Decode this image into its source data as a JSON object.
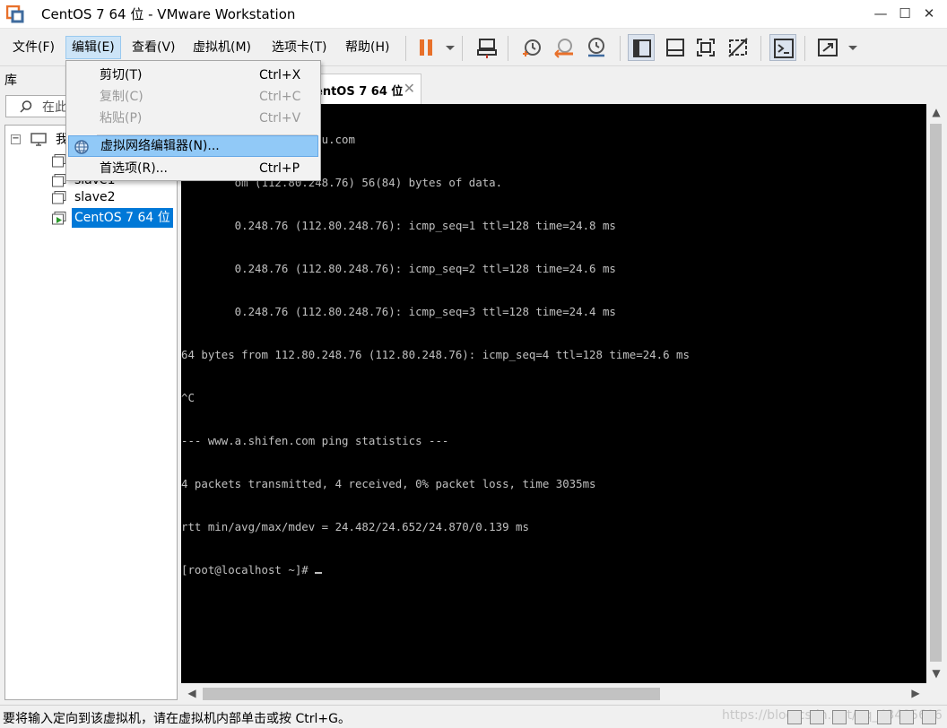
{
  "window": {
    "title": "CentOS 7 64 位 - VMware Workstation",
    "minimize": "—",
    "maximize": "☐",
    "close": "✕"
  },
  "menubar": {
    "items": [
      {
        "label": "文件(F)"
      },
      {
        "label": "编辑(E)"
      },
      {
        "label": "查看(V)"
      },
      {
        "label": "虚拟机(M)"
      },
      {
        "label": "选项卡(T)"
      },
      {
        "label": "帮助(H)"
      }
    ],
    "active_index": 1
  },
  "toolbar": {
    "icons": [
      "pause-icon",
      "dropdown-arrow-icon",
      "send-ctrl-alt-del-icon",
      "take-snapshot-icon",
      "revert-snapshot-icon",
      "snapshot-manager-icon",
      "show-library-icon",
      "thumbnail-bar-icon",
      "full-screen-icon",
      "unity-icon",
      "console-view-icon",
      "stretch-guest-icon",
      "stretch-dropdown-icon"
    ],
    "accent": "#e8702a"
  },
  "library": {
    "header": "库",
    "search_placeholder": "在此",
    "root_label": "我",
    "items": [
      {
        "label": ""
      },
      {
        "label": "slave1"
      },
      {
        "label": "slave2"
      },
      {
        "label": "CentOS 7 64 位"
      }
    ],
    "selected_index": 3
  },
  "tabs": {
    "active_label": "CentOS 7 64 位",
    "partial_visible_label": "entOS 7 64 位"
  },
  "edit_menu": {
    "items": [
      {
        "label": "剪切(T)",
        "shortcut": "Ctrl+X",
        "disabled": false
      },
      {
        "label": "复制(C)",
        "shortcut": "Ctrl+C",
        "disabled": true
      },
      {
        "label": "粘贴(P)",
        "shortcut": "Ctrl+V",
        "disabled": true
      },
      {
        "label": "虚拟网络编辑器(N)...",
        "shortcut": "",
        "disabled": false,
        "hovered": true
      },
      {
        "label": "首选项(R)...",
        "shortcut": "Ctrl+P",
        "disabled": false
      }
    ]
  },
  "console": {
    "lines": [
      "        ping www.baidu.com",
      "        om (112.80.248.76) 56(84) bytes of data.",
      "        0.248.76 (112.80.248.76): icmp_seq=1 ttl=128 time=24.8 ms",
      "        0.248.76 (112.80.248.76): icmp_seq=2 ttl=128 time=24.6 ms",
      "        0.248.76 (112.80.248.76): icmp_seq=3 ttl=128 time=24.4 ms",
      "64 bytes from 112.80.248.76 (112.80.248.76): icmp_seq=4 ttl=128 time=24.6 ms",
      "^C",
      "--- www.a.shifen.com ping statistics ---",
      "4 packets transmitted, 4 received, 0% packet loss, time 3035ms",
      "rtt min/avg/max/mdev = 24.482/24.652/24.870/0.139 ms",
      "[root@localhost ~]# "
    ]
  },
  "statusbar": {
    "text": "要将输入定向到该虚拟机，请在虚拟机内部单击或按 Ctrl+G。",
    "watermark": "https://blog.csdn.net/qq_43485606"
  }
}
